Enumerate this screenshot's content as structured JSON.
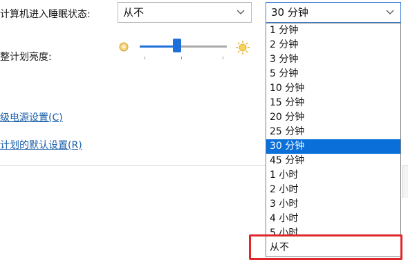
{
  "sleep": {
    "label": "计算机进入睡眠状态:",
    "battery_value": "从不",
    "plugged_value": "30 分钟"
  },
  "brightness": {
    "label": "整计划亮度:",
    "level_fraction": 0.43
  },
  "links": {
    "advanced": "级电源设置(C)",
    "restore": "计划的默认设置(R)"
  },
  "dropdown": {
    "options": [
      "1 分钟",
      "2 分钟",
      "3 分钟",
      "5 分钟",
      "10 分钟",
      "15 分钟",
      "20 分钟",
      "25 分钟",
      "30 分钟",
      "45 分钟",
      "1 小时",
      "2 小时",
      "3 小时",
      "4 小时",
      "5 小时",
      "从不"
    ],
    "selected_index": 8
  },
  "colors": {
    "accent": "#0a6fd9",
    "link": "#1a5ea8",
    "highlight_border": "#e0262a"
  },
  "icons": {
    "dim": "sun-dim-icon",
    "bright": "sun-bright-icon",
    "chevron": "chevron-down-icon"
  }
}
